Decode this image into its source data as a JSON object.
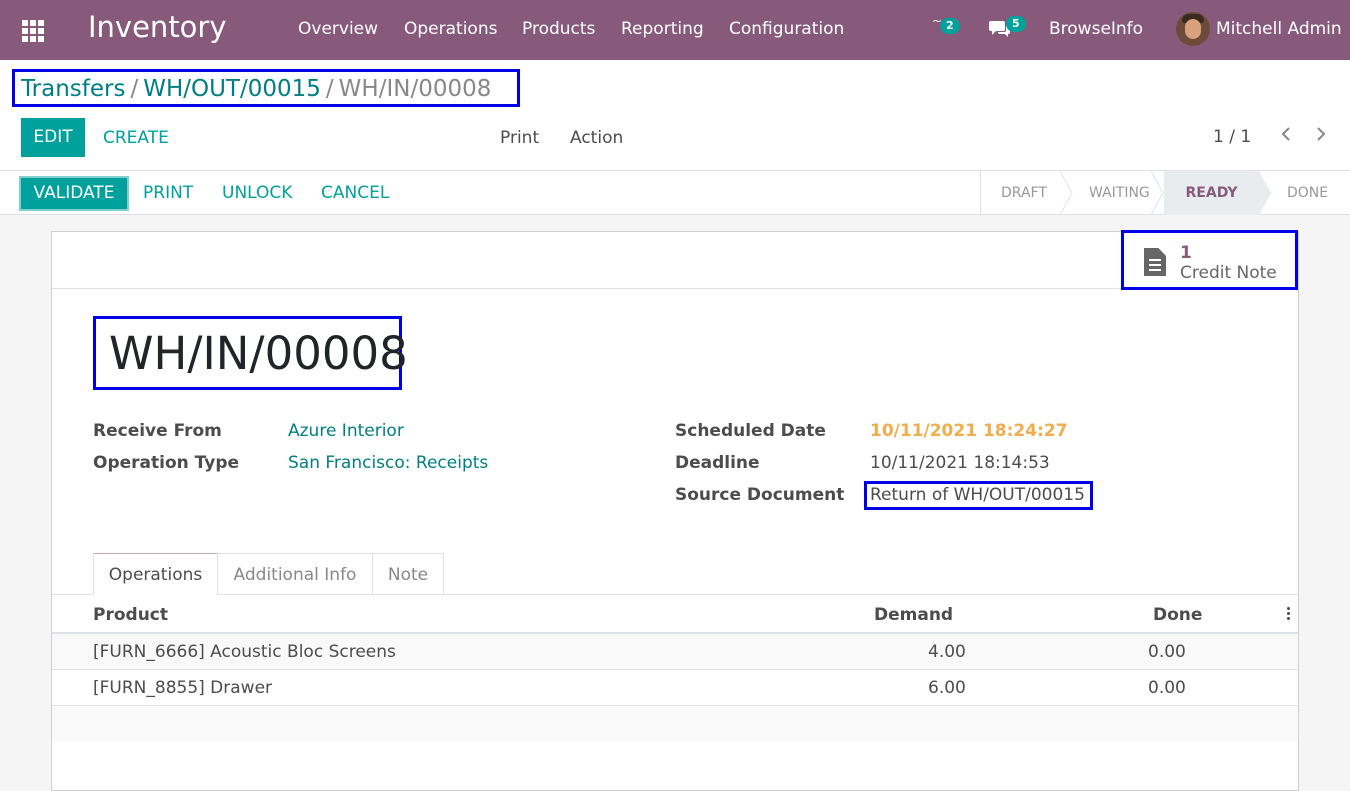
{
  "topbar": {
    "app_name": "Inventory",
    "menus": [
      "Overview",
      "Operations",
      "Products",
      "Reporting",
      "Configuration"
    ],
    "activity_badge": "2",
    "messages_badge": "5",
    "company": "BrowseInfo",
    "user": "Mitchell Admin"
  },
  "breadcrumb": {
    "items": [
      "Transfers",
      "WH/OUT/00015"
    ],
    "current": "WH/IN/00008",
    "sep": "/"
  },
  "control": {
    "edit_label": "EDIT",
    "create_label": "CREATE",
    "print_label": "Print",
    "action_label": "Action",
    "pager": "1 / 1"
  },
  "statusbar": {
    "validate_label": "VALIDATE",
    "print_label": "PRINT",
    "unlock_label": "UNLOCK",
    "cancel_label": "CANCEL",
    "stages": [
      "DRAFT",
      "WAITING",
      "READY",
      "DONE"
    ],
    "current_stage": "READY"
  },
  "smart_button": {
    "count": "1",
    "label": "Credit Note"
  },
  "record": {
    "name": "WH/IN/00008",
    "receive_from_label": "Receive From",
    "receive_from": "Azure Interior",
    "operation_type_label": "Operation Type",
    "operation_type": "San Francisco: Receipts",
    "scheduled_date_label": "Scheduled Date",
    "scheduled_date": "10/11/2021 18:24:27",
    "deadline_label": "Deadline",
    "deadline": "10/11/2021 18:14:53",
    "source_document_label": "Source Document",
    "source_document": "Return of WH/OUT/00015"
  },
  "tabs": [
    "Operations",
    "Additional Info",
    "Note"
  ],
  "table": {
    "headers": [
      "Product",
      "Demand",
      "Done"
    ],
    "rows": [
      {
        "product": "[FURN_6666] Acoustic Bloc Screens",
        "demand": "4.00",
        "done": "0.00"
      },
      {
        "product": "[FURN_8855] Drawer",
        "demand": "6.00",
        "done": "0.00"
      }
    ]
  },
  "colors": {
    "brand": "#875a7b",
    "primary": "#00a09d",
    "link": "#017e84",
    "warning": "#f0ad4e",
    "highlight_box": "#0000e6"
  }
}
